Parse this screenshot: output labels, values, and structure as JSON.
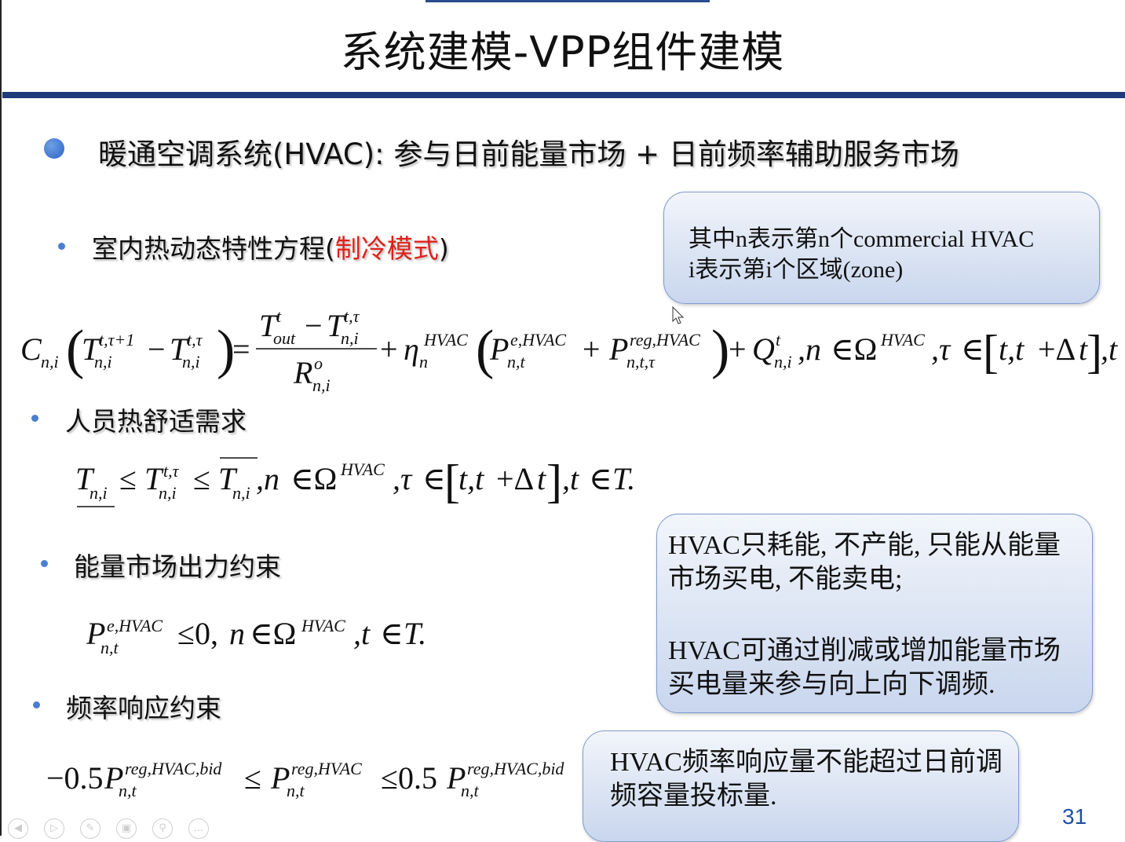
{
  "title": "系统建模-VPP组件建模",
  "heading": "暖通空调系统(HVAC): 参与日前能量市场 + 日前频率辅助服务市场",
  "sections": {
    "thermal": {
      "label_prefix": "室内热动态特性方程(",
      "label_red": "制冷模式",
      "label_suffix": ")"
    },
    "comfort": {
      "label": "人员热舒适需求"
    },
    "energy": {
      "label": "能量市场出力约束"
    },
    "frequency": {
      "label": "频率响应约束"
    }
  },
  "notes": {
    "index": {
      "line1": "其中n表示第n个commercial HVAC",
      "line2": "i表示第i个区域(zone)"
    },
    "energy": {
      "para1": "HVAC只耗能, 不产能, 只能从能量市场买电, 不能卖电;",
      "para2": "HVAC可通过削减或增加能量市场买电量来参与向上向下调频."
    },
    "frequency": {
      "text": "HVAC频率响应量不能超过日前调频容量投标量."
    }
  },
  "page_number": "31",
  "colors": {
    "accent": "#1f3a7a",
    "red": "#e0201a",
    "page_number": "#1f4fa8"
  },
  "icons": [
    "prev-icon",
    "play-icon",
    "pen-icon",
    "screen-icon",
    "zoom-icon",
    "more-icon"
  ]
}
